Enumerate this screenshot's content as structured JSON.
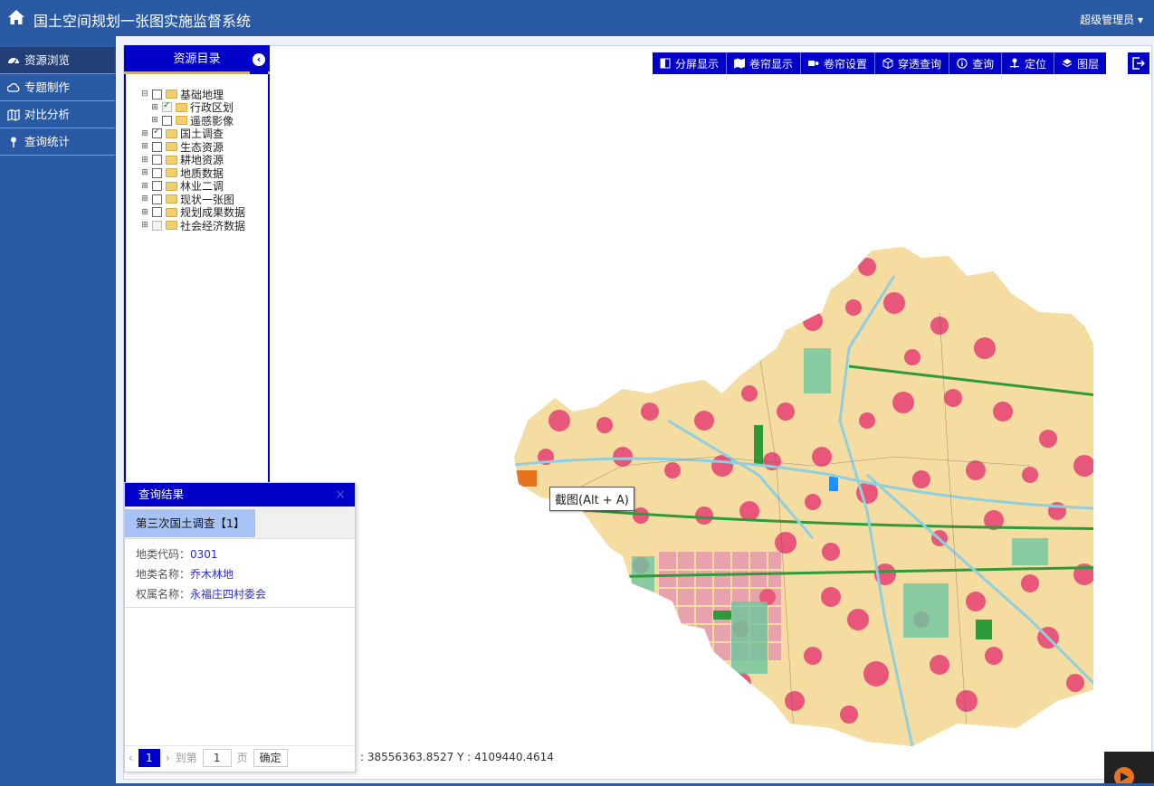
{
  "header": {
    "title": "国土空间规划一张图实施监督系统",
    "user": "超级管理员 ▾"
  },
  "sidebar": {
    "items": [
      {
        "label": "资源浏览",
        "icon": "dashboard-icon"
      },
      {
        "label": "专题制作",
        "icon": "cloud-icon"
      },
      {
        "label": "对比分析",
        "icon": "map-icon"
      },
      {
        "label": "查询统计",
        "icon": "pin-icon"
      }
    ]
  },
  "tree": {
    "title": "资源目录",
    "nodes": [
      {
        "label": "基础地理",
        "state": "unchecked",
        "exp": "⊟"
      },
      {
        "label": "行政区划",
        "state": "checked-disabled",
        "exp": "⊞",
        "child": true
      },
      {
        "label": "遥感影像",
        "state": "unchecked",
        "exp": "⊞",
        "child": true
      },
      {
        "label": "国土调查",
        "state": "checked",
        "exp": "⊞"
      },
      {
        "label": "生态资源",
        "state": "unchecked",
        "exp": "⊞"
      },
      {
        "label": "耕地资源",
        "state": "unchecked",
        "exp": "⊞"
      },
      {
        "label": "地质数据",
        "state": "unchecked",
        "exp": "⊞"
      },
      {
        "label": "林业二调",
        "state": "unchecked",
        "exp": "⊞"
      },
      {
        "label": "现状一张图",
        "state": "unchecked",
        "exp": "⊞"
      },
      {
        "label": "规划成果数据",
        "state": "unchecked",
        "exp": "⊞"
      },
      {
        "label": "社会经济数据",
        "state": "disabled",
        "exp": "⊞"
      }
    ]
  },
  "toolbar": {
    "split": "分屏显示",
    "swipe": "卷帘显示",
    "swipe_settings": "卷帘设置",
    "penetrate": "穿透查询",
    "query": "查询",
    "locate": "定位",
    "layers": "图层"
  },
  "tooltip": "截图(Alt + A)",
  "coords": ": 38556363.8527     Y : 4109440.4614",
  "result": {
    "title": "查询结果",
    "close": "×",
    "tab": "第三次国土调查【1】",
    "fields": [
      {
        "label": "地类代码：",
        "value": "0301"
      },
      {
        "label": "地类名称：",
        "value": "乔木林地"
      },
      {
        "label": "权属名称：",
        "value": "永福庄四村委会"
      }
    ],
    "pager": {
      "prev": "‹",
      "current": "1",
      "next": "›",
      "goto": "到第",
      "page_input": "1",
      "page_unit": "页",
      "ok": "确定"
    }
  },
  "colors": {
    "header": "#2b5aa5",
    "accent": "#0000c8",
    "land_base": "#f5dca0",
    "settlement": "#e8577a",
    "forest": "#2e9a3a",
    "water": "#8fcfe0"
  }
}
